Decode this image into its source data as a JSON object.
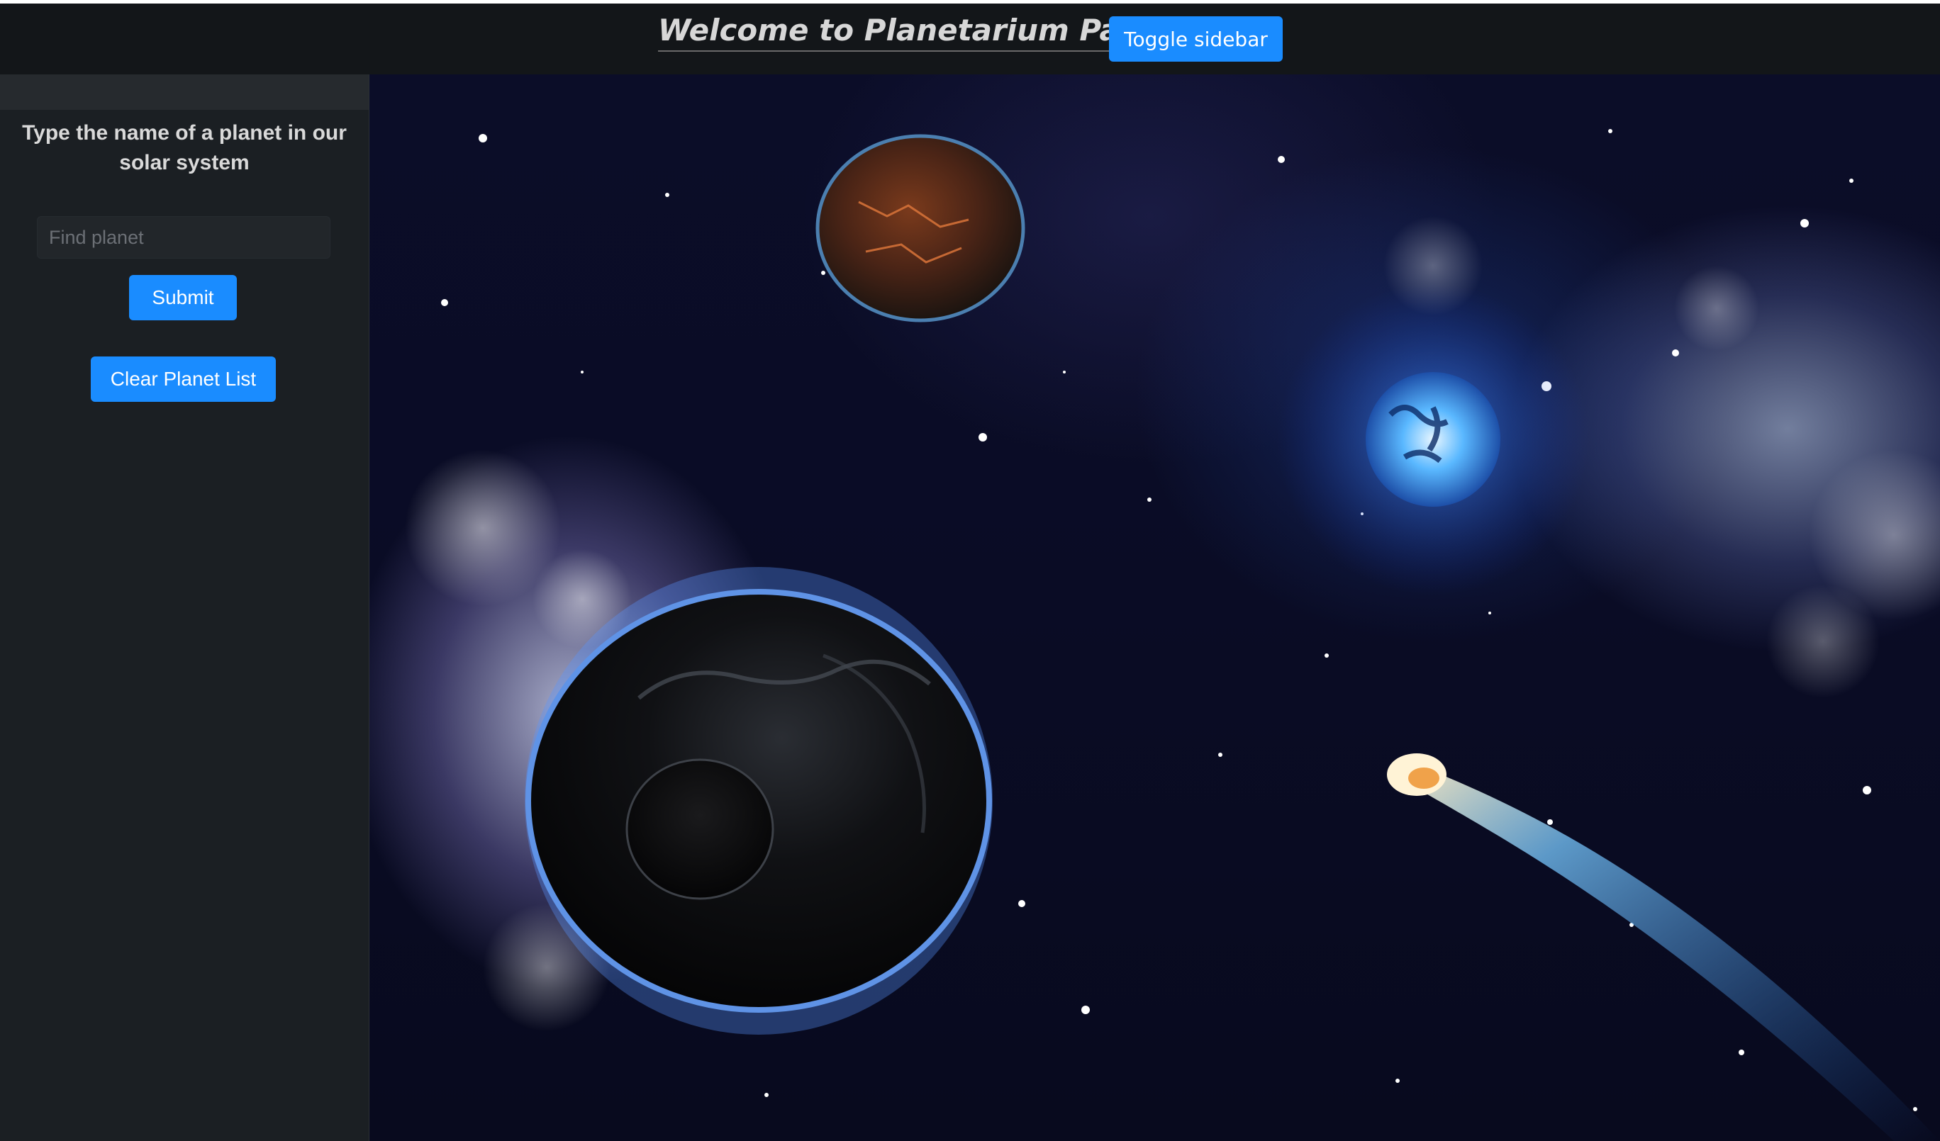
{
  "header": {
    "title": "Welcome to Planetarium Party",
    "toggle_label": "Toggle sidebar"
  },
  "sidebar": {
    "heading": "Type the name of a planet in our solar system",
    "search": {
      "placeholder": "Find planet",
      "value": ""
    },
    "submit_label": "Submit",
    "clear_label": "Clear Planet List"
  },
  "colors": {
    "accent": "#1a8cff",
    "background": "#131619",
    "sidebar": "#1b1f23"
  }
}
